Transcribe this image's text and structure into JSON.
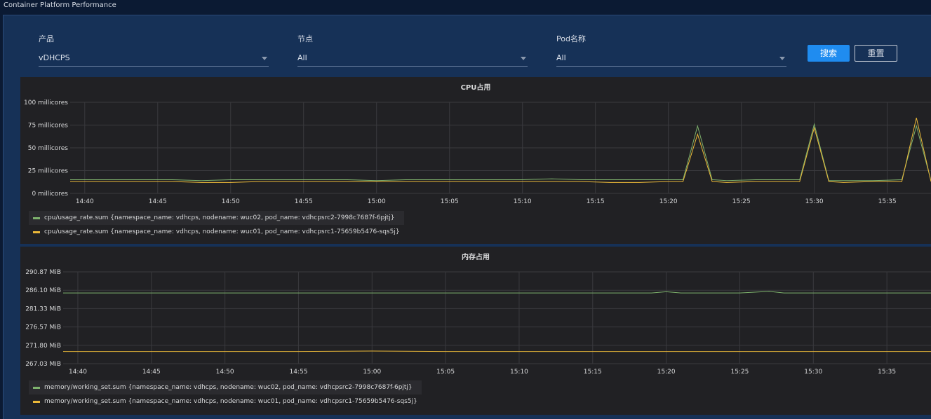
{
  "app": {
    "title": "Container Platform Performance"
  },
  "filters": {
    "product": {
      "label": "产品",
      "value": "vDHCPS"
    },
    "node": {
      "label": "节点",
      "value": "All"
    },
    "pod": {
      "label": "Pod名称",
      "value": "All"
    }
  },
  "buttons": {
    "search": "搜索",
    "reset": "重置"
  },
  "colors": {
    "series1": "#7eb26d",
    "series2": "#eab839"
  },
  "chart_data": [
    {
      "type": "line",
      "title": "CPU占用",
      "x_ticks": [
        "14:40",
        "14:45",
        "14:50",
        "14:55",
        "15:00",
        "15:05",
        "15:10",
        "15:15",
        "15:20",
        "15:25",
        "15:30",
        "15:35"
      ],
      "x_range": [
        "14:39",
        "15:38"
      ],
      "y_ticks": [
        "0 millicores",
        "25 millicores",
        "50 millicores",
        "75 millicores",
        "100 millicores"
      ],
      "ylim": [
        0,
        100
      ],
      "grid": true,
      "legend_position": "bottom-left",
      "x": [
        "14:39",
        "14:40",
        "14:42",
        "14:44",
        "14:46",
        "14:48",
        "14:50",
        "14:52",
        "14:54",
        "14:56",
        "14:58",
        "15:00",
        "15:02",
        "15:04",
        "15:06",
        "15:08",
        "15:10",
        "15:12",
        "15:14",
        "15:16",
        "15:18",
        "15:20",
        "15:21",
        "15:22",
        "15:23",
        "15:24",
        "15:26",
        "15:28",
        "15:29",
        "15:30",
        "15:31",
        "15:32",
        "15:34",
        "15:36",
        "15:37",
        "15:38"
      ],
      "series": [
        {
          "name": "cpu/usage_rate.sum {namespace_name: vdhcps, nodename: wuc02, pod_name: vdhcpsrc2-7998c7687f-6pjtj}",
          "values": [
            15,
            15,
            15,
            15,
            15,
            14,
            15,
            15,
            15,
            15,
            15,
            14,
            15,
            15,
            15,
            15,
            15,
            16,
            15,
            15,
            15,
            15,
            15,
            74,
            15,
            14,
            15,
            15,
            15,
            76,
            14,
            14,
            14,
            15,
            74,
            14
          ]
        },
        {
          "name": "cpu/usage_rate.sum {namespace_name: vdhcps, nodename: wuc01, pod_name: vdhcpsrc1-75659b5476-sqs5j}",
          "values": [
            13,
            13,
            13,
            13,
            13,
            12,
            12,
            13,
            13,
            13,
            13,
            13,
            13,
            13,
            13,
            13,
            13,
            13,
            13,
            12,
            12,
            13,
            13,
            65,
            13,
            12,
            13,
            13,
            13,
            72,
            13,
            12,
            13,
            13,
            83,
            13
          ]
        }
      ]
    },
    {
      "type": "line",
      "title": "内存占用",
      "x_ticks": [
        "14:40",
        "14:45",
        "14:50",
        "14:55",
        "15:00",
        "15:05",
        "15:10",
        "15:15",
        "15:20",
        "15:25",
        "15:30",
        "15:35"
      ],
      "x_range": [
        "14:39",
        "15:38"
      ],
      "y_ticks": [
        "267.03 MiB",
        "271.80 MiB",
        "276.57 MiB",
        "281.33 MiB",
        "286.10 MiB",
        "290.87 MiB"
      ],
      "ylim": [
        267.03,
        290.87
      ],
      "grid": true,
      "legend_position": "bottom-left",
      "x": [
        "14:39",
        "14:45",
        "14:50",
        "14:55",
        "15:00",
        "15:05",
        "15:10",
        "15:15",
        "15:19",
        "15:20",
        "15:21",
        "15:25",
        "15:27",
        "15:28",
        "15:30",
        "15:35",
        "15:38"
      ],
      "series": [
        {
          "name": "memory/working_set.sum {namespace_name: vdhcps, nodename: wuc02, pod_name: vdhcpsrc2-7998c7687f-6pjtj}",
          "values": [
            285.4,
            285.4,
            285.4,
            285.4,
            285.4,
            285.4,
            285.4,
            285.4,
            285.4,
            285.7,
            285.4,
            285.4,
            285.8,
            285.4,
            285.4,
            285.4,
            285.4
          ]
        },
        {
          "name": "memory/working_set.sum {namespace_name: vdhcps, nodename: wuc01, pod_name: vdhcpsrc1-75659b5476-sqs5j}",
          "values": [
            270.2,
            270.2,
            270.2,
            270.2,
            270.3,
            270.2,
            270.2,
            270.2,
            270.2,
            270.2,
            270.2,
            270.2,
            270.2,
            270.2,
            270.2,
            270.2,
            270.2
          ]
        }
      ]
    }
  ]
}
